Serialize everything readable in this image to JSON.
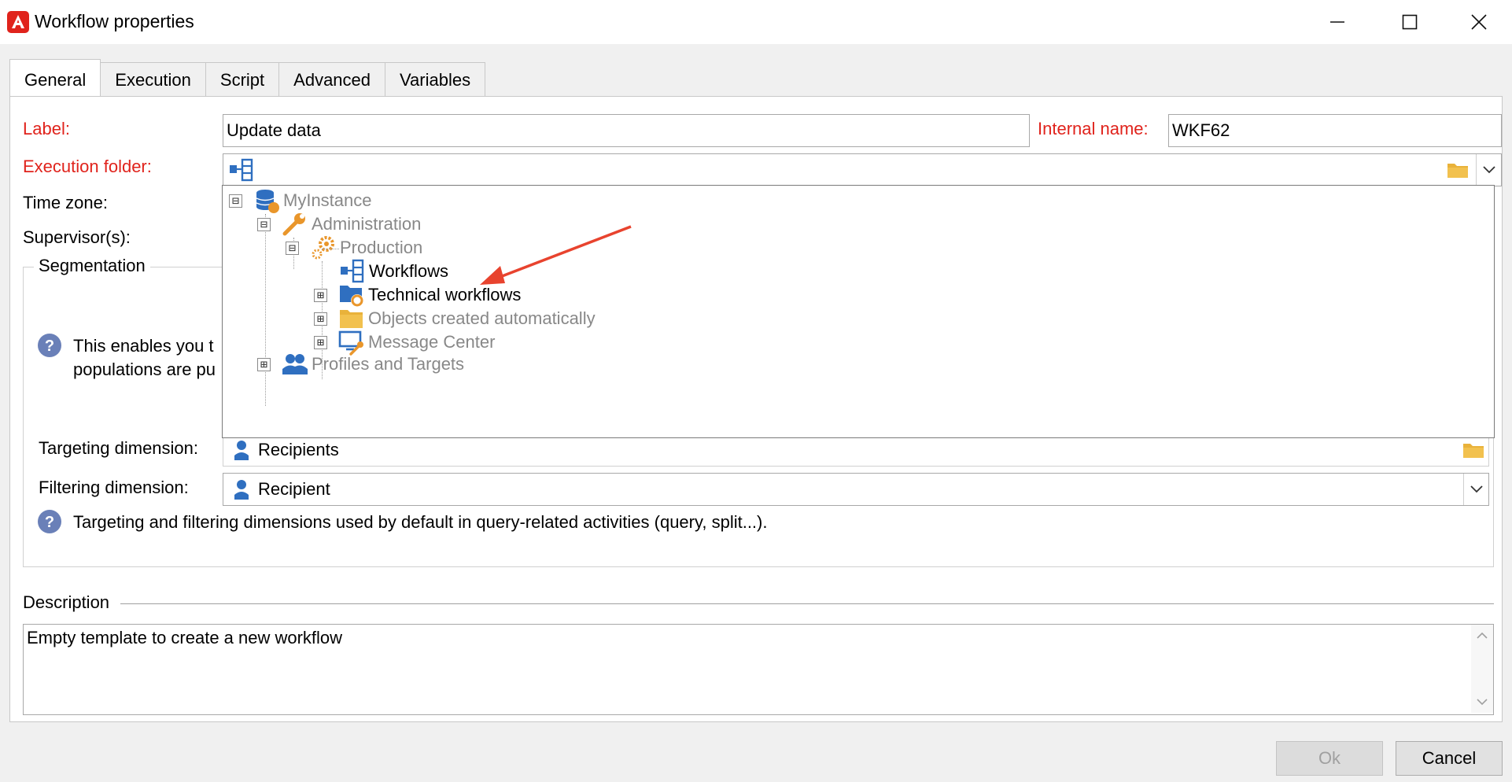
{
  "window": {
    "title": "Workflow properties",
    "minimize_icon": "minimize-icon",
    "maximize_icon": "maximize-icon",
    "close_icon": "close-icon"
  },
  "tabs": [
    {
      "label": "General",
      "active": true
    },
    {
      "label": "Execution",
      "active": false
    },
    {
      "label": "Script",
      "active": false
    },
    {
      "label": "Advanced",
      "active": false
    },
    {
      "label": "Variables",
      "active": false
    }
  ],
  "general": {
    "label_caption": "Label:",
    "label_value": "Update data",
    "internal_name_caption": "Internal name:",
    "internal_name_value": "WKF62",
    "execution_folder_caption": "Execution folder:",
    "time_zone_caption": "Time zone:",
    "supervisors_caption": "Supervisor(s):"
  },
  "folder_tree": {
    "nodes": [
      {
        "label": "MyInstance",
        "expander": "⊟",
        "icon": "database-icon"
      },
      {
        "label": "Administration",
        "expander": "⊟",
        "icon": "wrench-icon"
      },
      {
        "label": "Production",
        "expander": "⊟",
        "icon": "gears-icon"
      },
      {
        "label": "Workflows",
        "expander": "",
        "icon": "workflow-icon"
      },
      {
        "label": "Technical workflows",
        "expander": "⊞",
        "icon": "technical-workflows-icon"
      },
      {
        "label": "Objects created automatically",
        "expander": "⊞",
        "icon": "folder-icon"
      },
      {
        "label": "Message Center",
        "expander": "⊞",
        "icon": "message-center-icon"
      },
      {
        "label": "Profiles and Targets",
        "expander": "⊞",
        "icon": "profiles-icon"
      }
    ]
  },
  "segmentation": {
    "title": "Segmentation",
    "help_line1": "This enables you t",
    "help_line2": "populations are pu",
    "targeting_caption": "Targeting dimension:",
    "targeting_value": "Recipients",
    "filtering_caption": "Filtering dimension:",
    "filtering_value": "Recipient",
    "dimensions_help": "Targeting and filtering dimensions used by default in query-related activities (query, split...)."
  },
  "description": {
    "title": "Description",
    "value": "Empty template to create a new workflow"
  },
  "buttons": {
    "ok": "Ok",
    "cancel": "Cancel"
  },
  "colors": {
    "required": "#e0231c",
    "arrow": "#e8432e",
    "icon_blue": "#2f6fc0",
    "icon_orange": "#e9962b"
  }
}
